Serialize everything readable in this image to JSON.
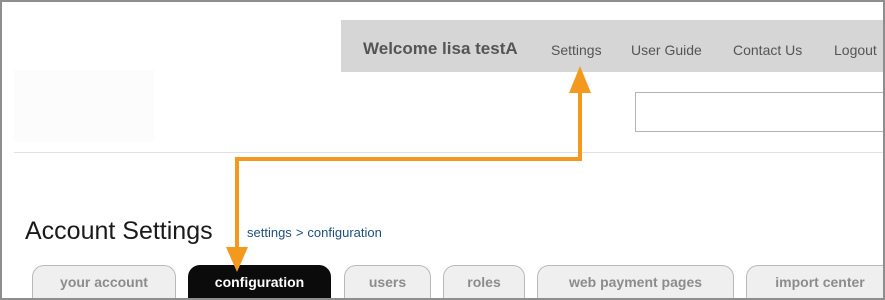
{
  "header": {
    "welcome_text": "Welcome lisa testA",
    "links": {
      "settings": "Settings",
      "user_guide": "User Guide",
      "contact_us": "Contact Us",
      "logout": "Logout"
    },
    "search": {
      "value": "",
      "placeholder": ""
    }
  },
  "page": {
    "title": "Account Settings",
    "breadcrumb": {
      "parent": "settings",
      "separator": ">",
      "current": "configuration"
    }
  },
  "tabs": [
    {
      "label": "your account",
      "active": false
    },
    {
      "label": "configuration",
      "active": true
    },
    {
      "label": "users",
      "active": false
    },
    {
      "label": "roles",
      "active": false
    },
    {
      "label": "web payment pages",
      "active": false
    },
    {
      "label": "import center",
      "active": false
    }
  ],
  "annotation": {
    "arrow_color": "#f39a1e"
  },
  "colors": {
    "topbar_bg": "#d6d6d6",
    "active_tab_bg": "#0b0b0b",
    "inactive_tab_bg": "#efefef",
    "breadcrumb_link": "#1e4f7a"
  }
}
